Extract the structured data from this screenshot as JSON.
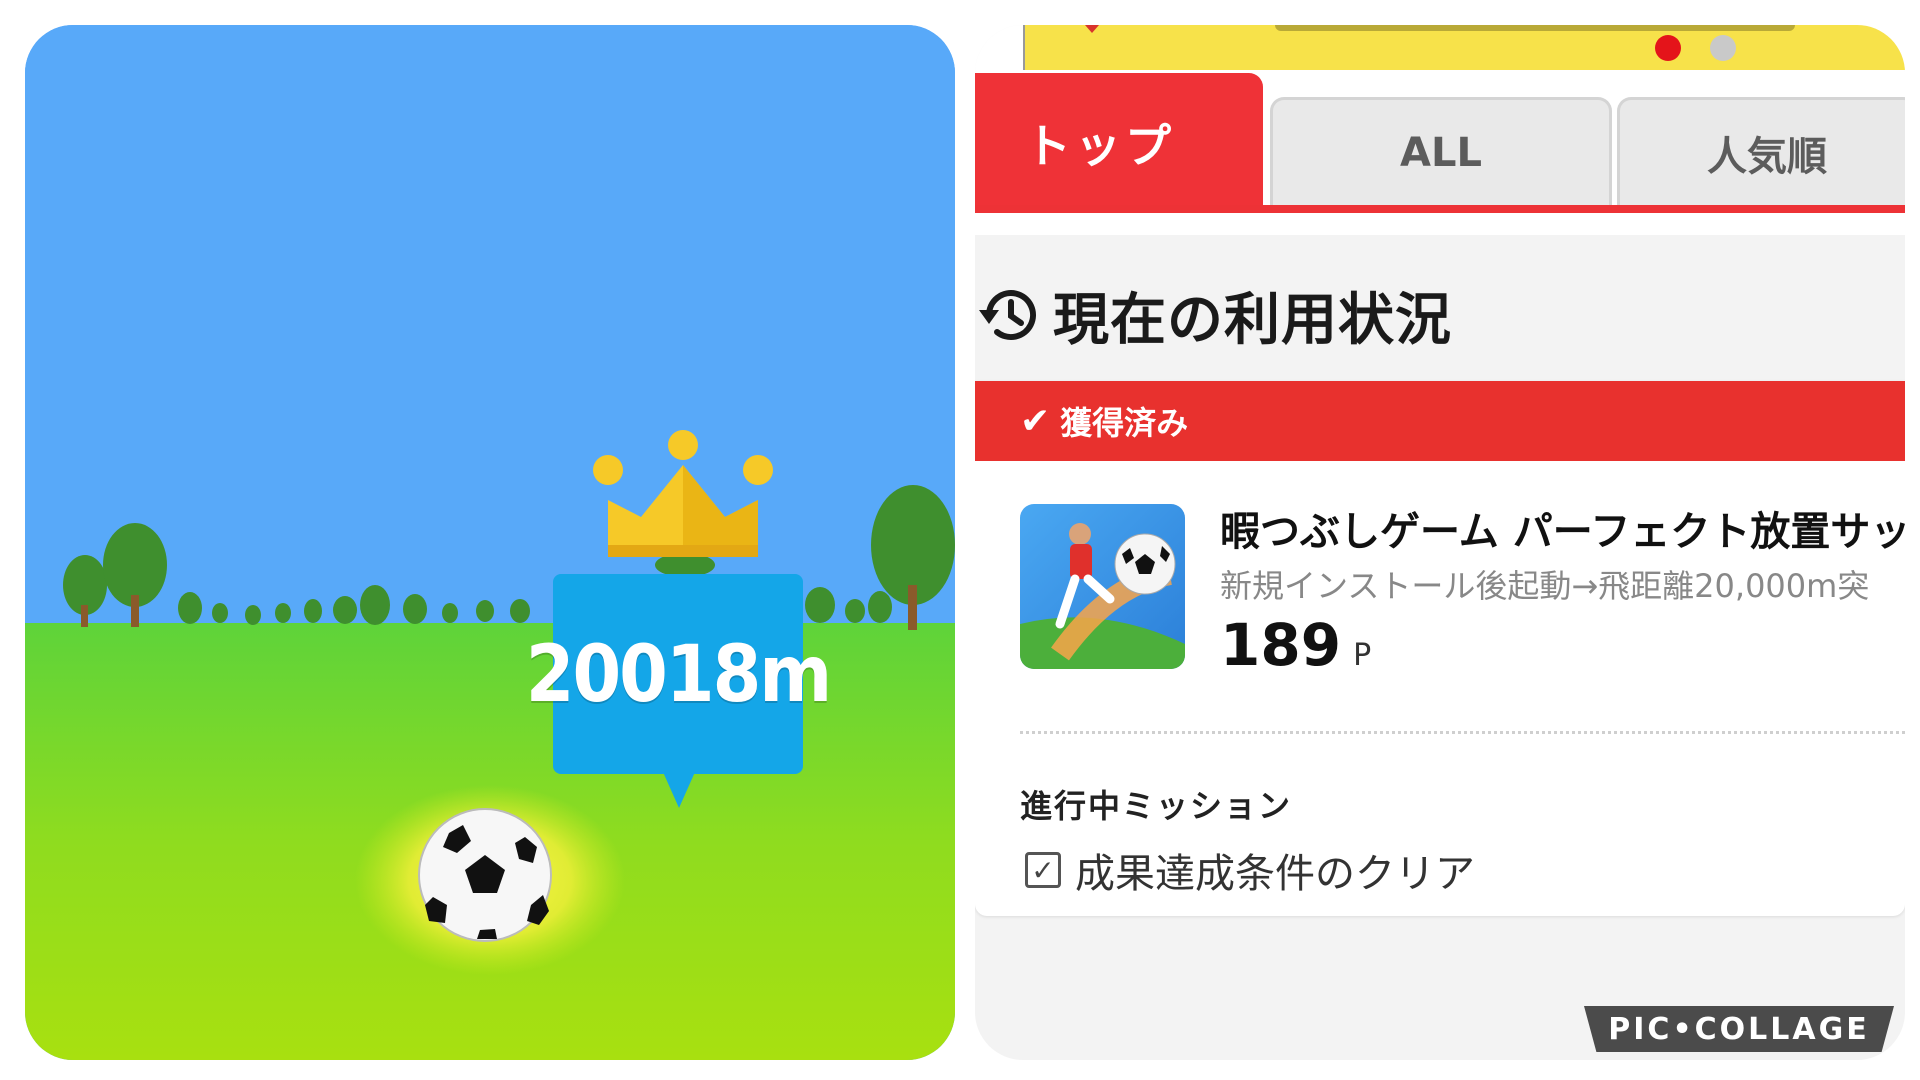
{
  "game": {
    "distance": "20018m"
  },
  "app": {
    "tabs": [
      {
        "label": "トップ",
        "active": true
      },
      {
        "label": "ALL",
        "active": false
      },
      {
        "label": "人気順",
        "active": false
      }
    ],
    "carousel": {
      "slide_count": 2,
      "active_index": 0
    },
    "section_title": "現在の利用状況",
    "card": {
      "status": "獲得済み",
      "app_name": "暇つぶしゲーム パーフェクト放置サッ",
      "description": "新規インストール後起動→飛距離20,000m突",
      "points_value": "189",
      "points_unit": "P",
      "mission_title": "進行中ミッション",
      "mission_item": "成果達成条件のクリア",
      "mission_checked": true
    },
    "accent_color": "#ef3237"
  },
  "watermark": "PIC•COLLAGE",
  "icons": [
    "crown-icon",
    "soccer-ball-icon",
    "history-icon",
    "check-icon",
    "checkbox-icon"
  ]
}
